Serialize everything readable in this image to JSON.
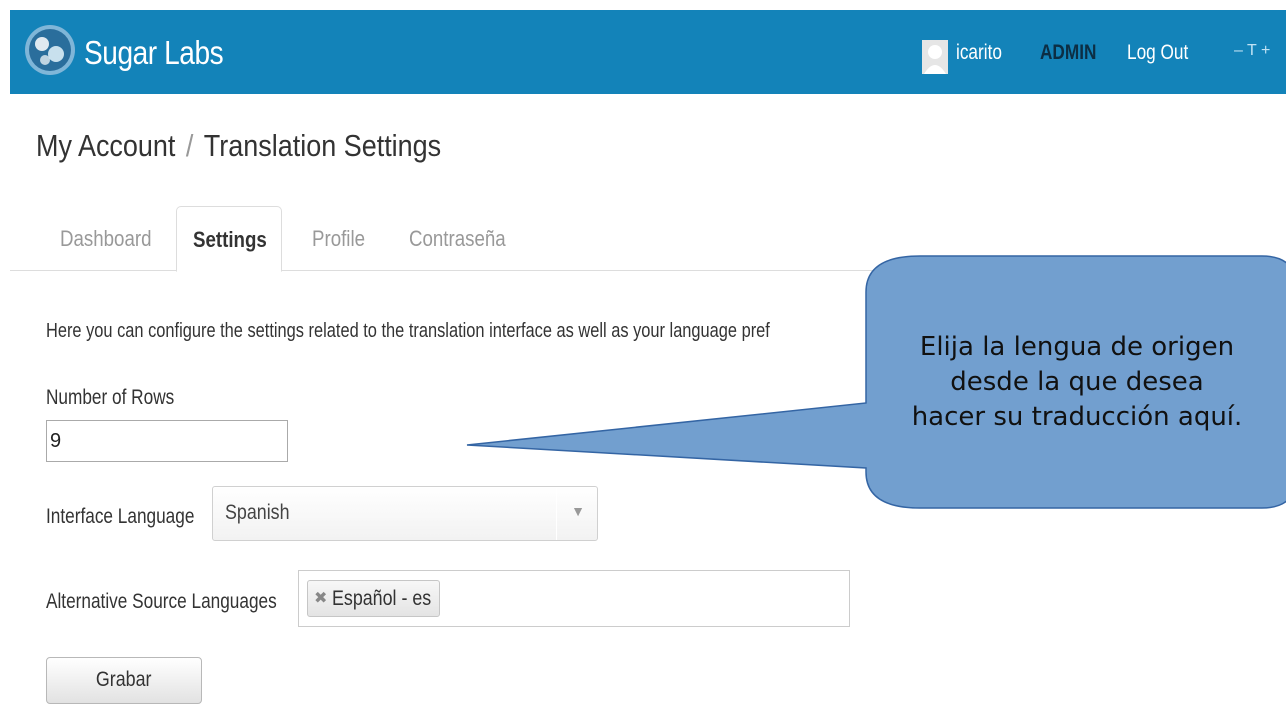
{
  "header": {
    "brand": "Sugar Labs",
    "username": "icarito",
    "admin_label": "ADMIN",
    "logout_label": "Log Out",
    "extra_controls": "– T +",
    "color": "#1383b9"
  },
  "breadcrumb": {
    "parent": "My Account",
    "separator": "/",
    "current": "Translation Settings"
  },
  "tabs": [
    {
      "label": "Dashboard",
      "active": false
    },
    {
      "label": "Settings",
      "active": true
    },
    {
      "label": "Profile",
      "active": false
    },
    {
      "label": "Contraseña",
      "active": false
    }
  ],
  "form": {
    "intro": "Here you can configure the settings related to the translation interface as well as your language pref",
    "rows_label": "Number of Rows",
    "rows_value": "9",
    "interface_language_label": "Interface Language",
    "interface_language_value": "Spanish",
    "alt_source_label": "Alternative Source Languages",
    "alt_source_chips": [
      "Español - es"
    ],
    "save_label": "Grabar"
  },
  "callout": {
    "lines": [
      "Elija la lengua de origen",
      "desde la que desea",
      "hacer su traducción aquí."
    ],
    "fill": "#729fcf",
    "stroke": "#3465a4"
  }
}
